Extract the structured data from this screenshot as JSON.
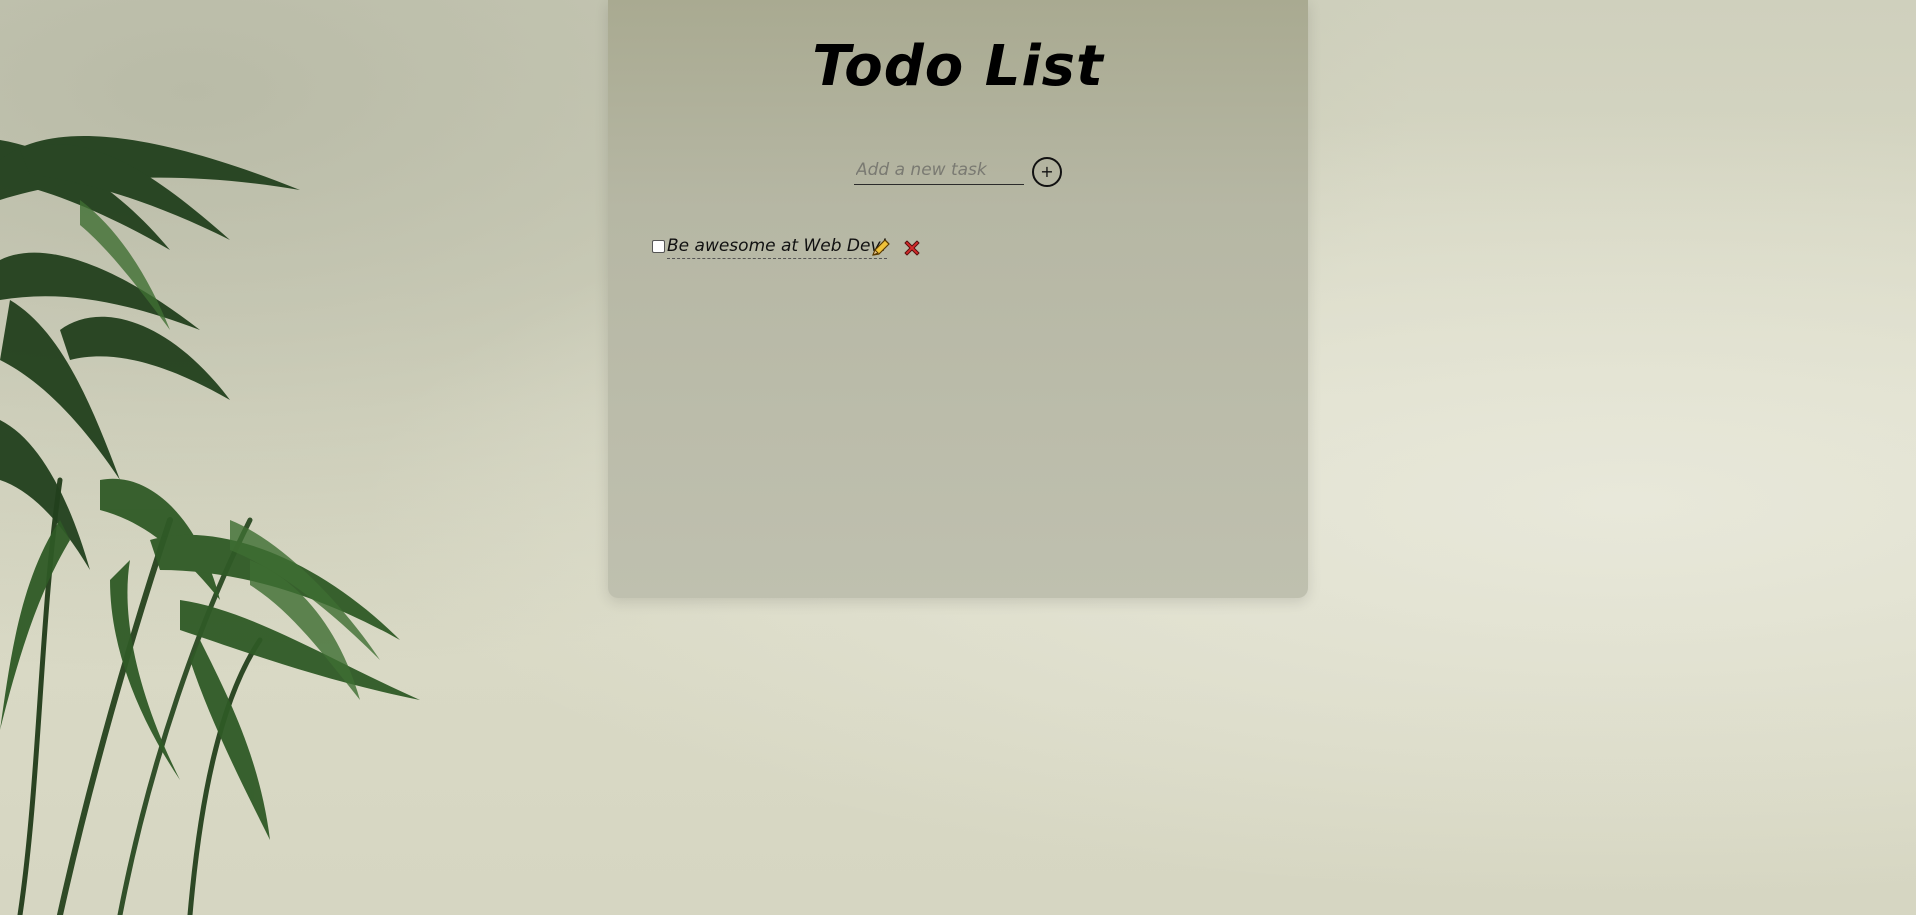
{
  "app": {
    "title": "Todo List"
  },
  "new_task": {
    "placeholder": "Add a new task",
    "value": "",
    "add_label": "+"
  },
  "todos": [
    {
      "text": "Be awesome at Web Dev!",
      "completed": false
    }
  ],
  "icons": {
    "add": "plus-circle-icon",
    "edit": "pencil-icon",
    "delete": "cross-icon"
  },
  "colors": {
    "card": "#b6b7a4",
    "wall": "#dcdcc8",
    "text": "#111111",
    "delete_red": "#d62b2b",
    "pencil_yellow": "#f0c23a"
  }
}
